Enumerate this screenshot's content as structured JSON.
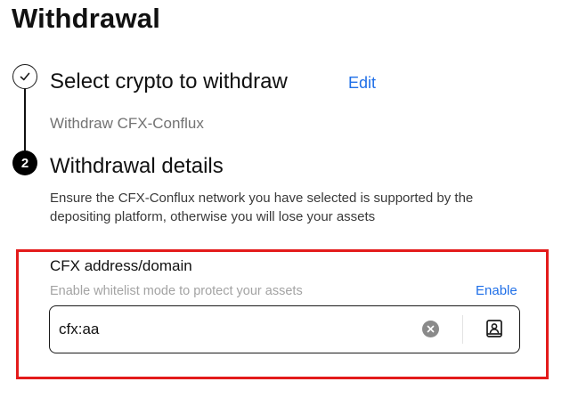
{
  "page": {
    "title": "Withdrawal"
  },
  "step1": {
    "title": "Select crypto to withdraw",
    "edit_label": "Edit",
    "subtitle": "Withdraw CFX-Conflux",
    "status": "completed"
  },
  "step2": {
    "number": "2",
    "title": "Withdrawal details",
    "warning": "Ensure the CFX-Conflux network you have selected is supported by the depositing platform, otherwise you will lose your assets"
  },
  "address_field": {
    "label": "CFX address/domain",
    "hint": "Enable whitelist mode to protect your assets",
    "enable_label": "Enable",
    "value": "cfx:aa",
    "clear_icon": "clear-circle-icon",
    "book_icon": "address-book-icon"
  },
  "colors": {
    "accent": "#1f6fe8",
    "highlight": "#e31b1b",
    "text": "#111111",
    "muted": "#737373"
  }
}
